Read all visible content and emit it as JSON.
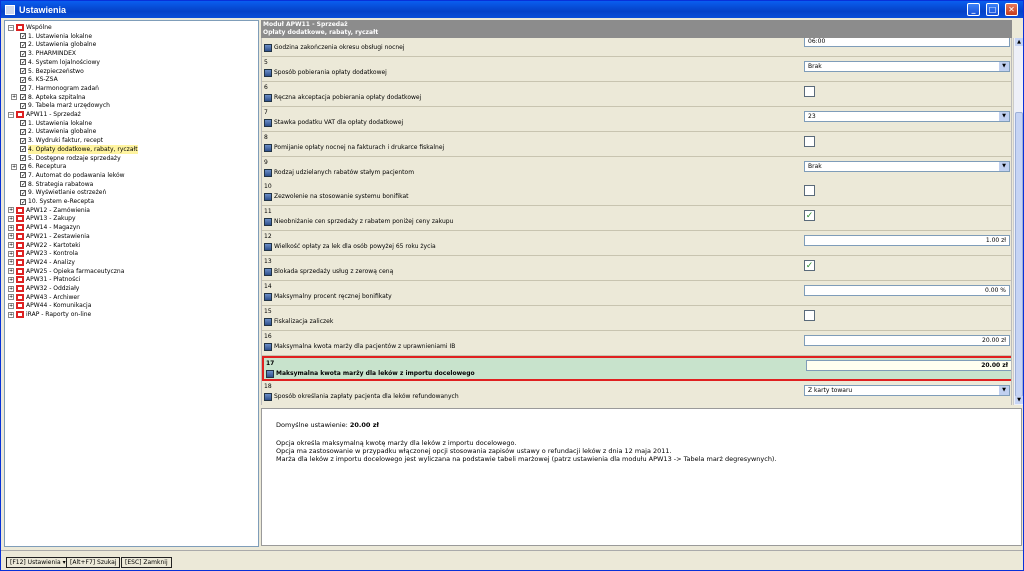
{
  "window": {
    "title": "Ustawienia"
  },
  "tree": [
    {
      "label": "Wspólne",
      "lvl": 0,
      "type": "mod",
      "open": true
    },
    {
      "label": "1. Ustawienia lokalne",
      "lvl": 1,
      "type": "chk"
    },
    {
      "label": "2. Ustawienia globalne",
      "lvl": 1,
      "type": "chk"
    },
    {
      "label": "3. PHARMINDEX",
      "lvl": 1,
      "type": "chk"
    },
    {
      "label": "4. System lojalnościowy",
      "lvl": 1,
      "type": "chk"
    },
    {
      "label": "5. Bezpieczeństwo",
      "lvl": 1,
      "type": "chk"
    },
    {
      "label": "6. KS-ZSA",
      "lvl": 1,
      "type": "chk"
    },
    {
      "label": "7. Harmonogram zadań",
      "lvl": 1,
      "type": "chk"
    },
    {
      "label": "8. Apteka szpitalna",
      "lvl": 1,
      "type": "chk",
      "exp": true
    },
    {
      "label": "9. Tabela marż urzędowych",
      "lvl": 1,
      "type": "chk"
    },
    {
      "label": "APW11 - Sprzedaż",
      "lvl": 0,
      "type": "mod",
      "open": true
    },
    {
      "label": "1. Ustawienia lokalne",
      "lvl": 1,
      "type": "chk"
    },
    {
      "label": "2. Ustawienia globalne",
      "lvl": 1,
      "type": "chk"
    },
    {
      "label": "3. Wydruki faktur, recept",
      "lvl": 1,
      "type": "chk"
    },
    {
      "label": "4. Opłaty dodatkowe, rabaty, ryczałt",
      "lvl": 1,
      "type": "chk",
      "selected": true
    },
    {
      "label": "5. Dostępne rodzaje sprzedaży",
      "lvl": 1,
      "type": "chk"
    },
    {
      "label": "6. Receptura",
      "lvl": 1,
      "type": "chk",
      "exp": true
    },
    {
      "label": "7. Automat do podawania leków",
      "lvl": 1,
      "type": "chk"
    },
    {
      "label": "8. Strategia rabatowa",
      "lvl": 1,
      "type": "chk"
    },
    {
      "label": "9. Wyświetlanie ostrzeżeń",
      "lvl": 1,
      "type": "chk"
    },
    {
      "label": "10. System e-Recepta",
      "lvl": 1,
      "type": "chk"
    },
    {
      "label": "APW12 - Zamówienia",
      "lvl": 0,
      "type": "mod"
    },
    {
      "label": "APW13 - Zakupy",
      "lvl": 0,
      "type": "mod"
    },
    {
      "label": "APW14 - Magazyn",
      "lvl": 0,
      "type": "mod"
    },
    {
      "label": "APW21 - Zestawienia",
      "lvl": 0,
      "type": "mod"
    },
    {
      "label": "APW22 - Kartoteki",
      "lvl": 0,
      "type": "mod"
    },
    {
      "label": "APW23 - Kontrola",
      "lvl": 0,
      "type": "mod"
    },
    {
      "label": "APW24 - Analizy",
      "lvl": 0,
      "type": "mod"
    },
    {
      "label": "APW25 - Opieka farmaceutyczna",
      "lvl": 0,
      "type": "mod"
    },
    {
      "label": "APW31 - Płatności",
      "lvl": 0,
      "type": "mod"
    },
    {
      "label": "APW32 - Oddziały",
      "lvl": 0,
      "type": "mod"
    },
    {
      "label": "APW43 - Archiwer",
      "lvl": 0,
      "type": "mod"
    },
    {
      "label": "APW44 - Komunikacja",
      "lvl": 0,
      "type": "mod"
    },
    {
      "label": "iRAP - Raporty on-line",
      "lvl": 0,
      "type": "mod"
    }
  ],
  "header": {
    "line1": "Moduł APW11 - Sprzedaż",
    "line2": "Opłaty dodatkowe, rabaty, ryczałt"
  },
  "settings": [
    {
      "num": "",
      "label": "Godzina zakończenia okresu obsługi nocnej",
      "ctl": "text",
      "value": "06:00"
    },
    {
      "num": "5",
      "label": "Sposób pobierania opłaty dodatkowej",
      "ctl": "select",
      "value": "Brak"
    },
    {
      "num": "6",
      "label": "Ręczna akceptacja pobierania opłaty dodatkowej",
      "ctl": "check",
      "checked": false
    },
    {
      "num": "7",
      "label": "Stawka podatku VAT dla opłaty dodatkowej",
      "ctl": "select",
      "value": "23"
    },
    {
      "num": "8",
      "label": "Pomijanie opłaty nocnej na fakturach i drukarce fiskalnej",
      "ctl": "check",
      "checked": false
    },
    {
      "num": "9",
      "label": "Rodzaj udzielanych rabatów stałym pacjentom",
      "ctl": "select",
      "value": "Brak"
    },
    {
      "num": "10",
      "label": "Zezwolenie na stosowanie systemu bonifikat",
      "ctl": "check",
      "checked": false
    },
    {
      "num": "11",
      "label": "Nieobniżanie cen sprzedaży z rabatem poniżej ceny zakupu",
      "ctl": "check",
      "checked": true
    },
    {
      "num": "12",
      "label": "Wielkość opłaty za lek dla osób powyżej 65 roku życia",
      "ctl": "num",
      "value": "1.00 zł"
    },
    {
      "num": "13",
      "label": "Blokada sprzedaży usług z zerową ceną",
      "ctl": "check",
      "checked": true
    },
    {
      "num": "14",
      "label": "Maksymalny procent ręcznej bonifikaty",
      "ctl": "num",
      "value": "0.00 %"
    },
    {
      "num": "15",
      "label": "Fiskalizacja zaliczek",
      "ctl": "check",
      "checked": false
    },
    {
      "num": "16",
      "label": "Maksymalna kwota marży dla pacjentów z uprawnieniami IB",
      "ctl": "num",
      "value": "20.00 zł"
    },
    {
      "num": "17",
      "label": "Maksymalna kwota marży dla leków z importu docelowego",
      "ctl": "num",
      "value": "20.00 zł",
      "highlight": true
    },
    {
      "num": "18",
      "label": "Sposób określania zapłaty pacjenta dla leków refundowanych",
      "ctl": "select",
      "value": "Z karty towaru"
    }
  ],
  "description": {
    "default_label": "Domyślne ustawienie:",
    "default_value": "20.00 zł",
    "lines": [
      "Opcja określa maksymalną kwotę marży dla leków z importu docelowego.",
      "Opcja ma zastosowanie w przypadku włączonej opcji stosowania zapisów ustawy o refundacji leków z dnia 12 maja 2011.",
      "Marża dla leków z importu docelowego jest wyliczana na podstawie tabeli marżowej (patrz ustawienia dla modułu APW13 -> Tabela marż degresywnych)."
    ]
  },
  "statusbar": {
    "b1": "[F12] Ustawienia",
    "b2": "[Alt+F7] Szukaj",
    "b3": "[ESC] Zamknij"
  }
}
